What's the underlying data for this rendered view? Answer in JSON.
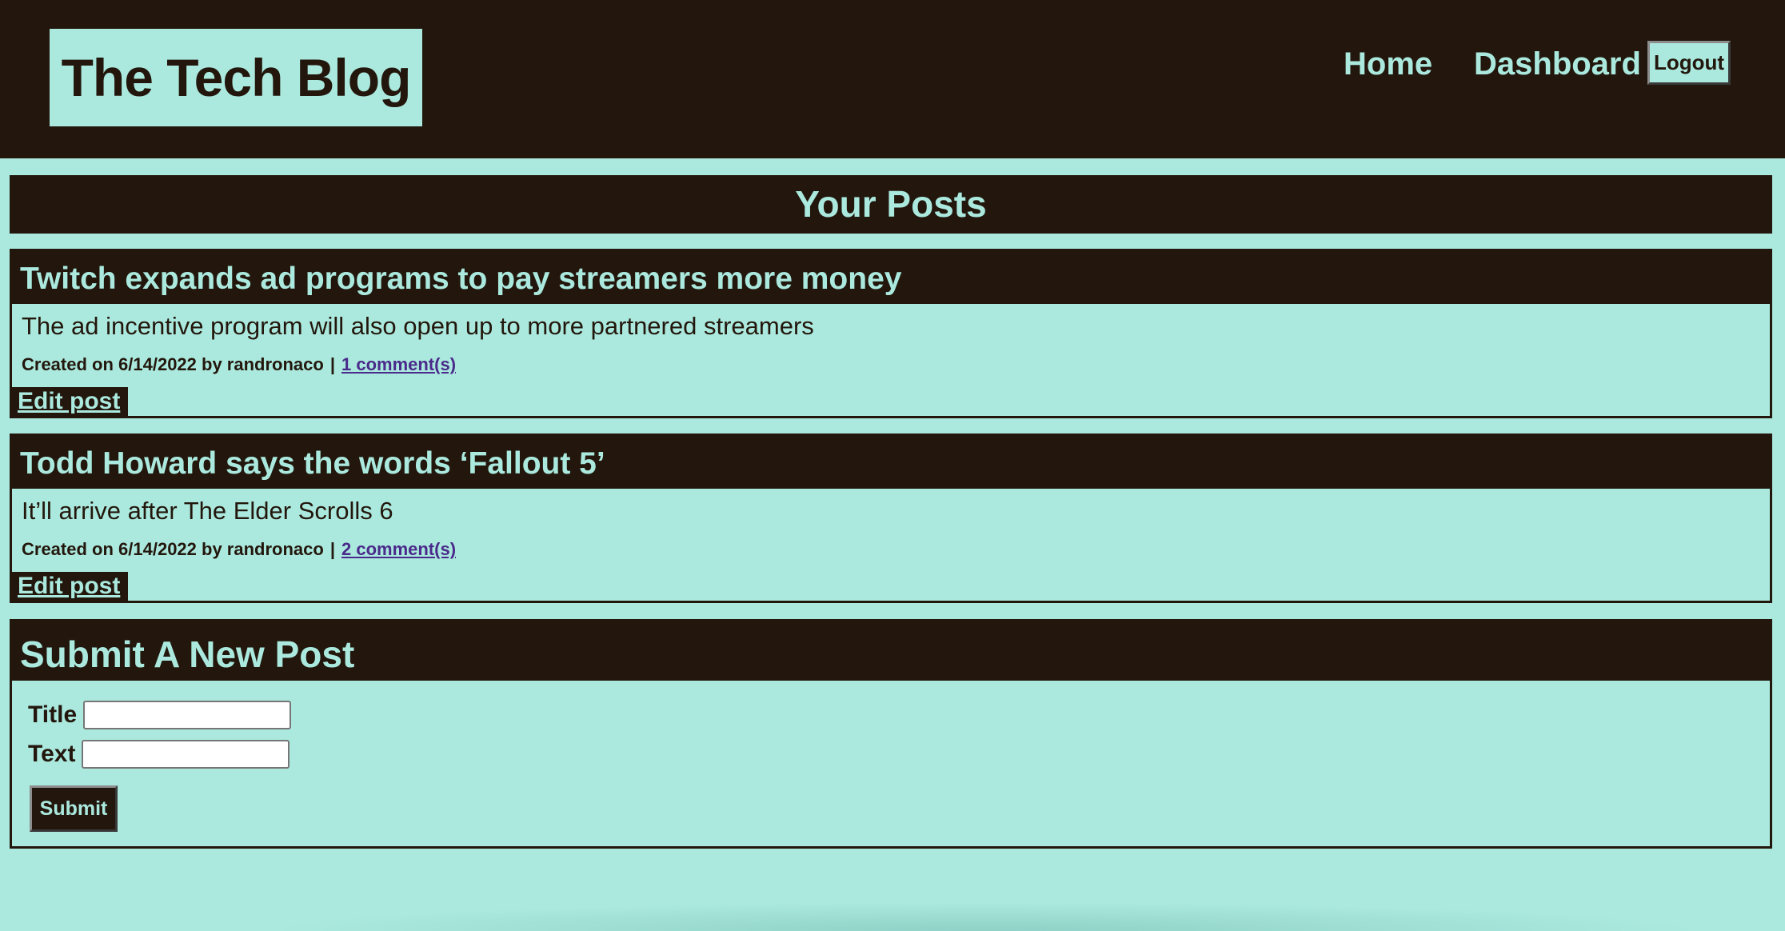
{
  "header": {
    "site_title": "The Tech Blog",
    "nav": {
      "home": "Home",
      "dashboard": "Dashboard",
      "logout": "Logout"
    }
  },
  "main": {
    "heading": "Your Posts",
    "posts": [
      {
        "title": "Twitch expands ad programs to pay streamers more money",
        "body": "The ad incentive program will also open up to more partnered streamers",
        "created": "Created on 6/14/2022 by randronaco",
        "separator": "|",
        "comments": "1 comment(s)",
        "edit_label": "Edit post"
      },
      {
        "title": "Todd Howard says the words ‘Fallout 5’",
        "body": "It’ll arrive after The Elder Scrolls 6",
        "created": "Created on 6/14/2022 by randronaco",
        "separator": "|",
        "comments": "2 comment(s)",
        "edit_label": "Edit post"
      }
    ],
    "new_post": {
      "heading": "Submit A New Post",
      "title_label": "Title",
      "title_value": "",
      "text_label": "Text",
      "text_value": "",
      "submit_label": "Submit"
    }
  },
  "colors": {
    "dark": "#23170d",
    "mint": "#abe9de",
    "link": "#4a2a8a"
  }
}
